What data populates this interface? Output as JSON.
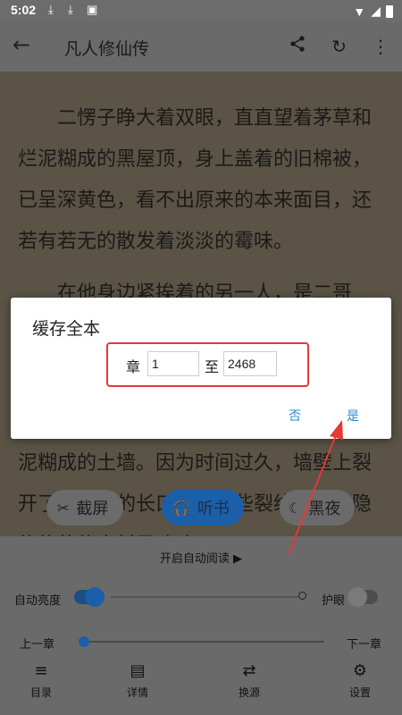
{
  "status_bar": {
    "time": "5:02"
  },
  "app_bar": {
    "title": "凡人修仙传"
  },
  "content": {
    "para1": "二愣子睁大着双眼，直直望着茅草和烂泥糊成的黑屋顶，身上盖着的旧棉被，已呈深黄色，看不出原来的本来面目，还若有若无的散发着淡淡的霉味。",
    "para2": "在他身边紧挨着的另一人，是二哥",
    "para3": "泥糊成的土墙。因为时间过久，墙壁上裂开了不起眼的长口子，这些裂纹中，隐隐约约的传来村民嘛嘛叨叨"
  },
  "dialog": {
    "title": "缓存全本",
    "from_label": "章",
    "from_value": "1",
    "to_label": "至",
    "to_value": "2468",
    "cancel": "否",
    "confirm": "是"
  },
  "floating": {
    "screenshot": "截屏",
    "listen": "听书",
    "night": "黑夜"
  },
  "panel": {
    "auto_read": "开启自动阅读 ▶",
    "brightness_label": "自动亮度",
    "eye_care_label": "护眼",
    "prev_chapter": "上一章",
    "next_chapter": "下一章",
    "progress": 0
  },
  "bottom_nav": {
    "toc": "目录",
    "details": "详情",
    "source": "换源",
    "settings": "设置"
  }
}
